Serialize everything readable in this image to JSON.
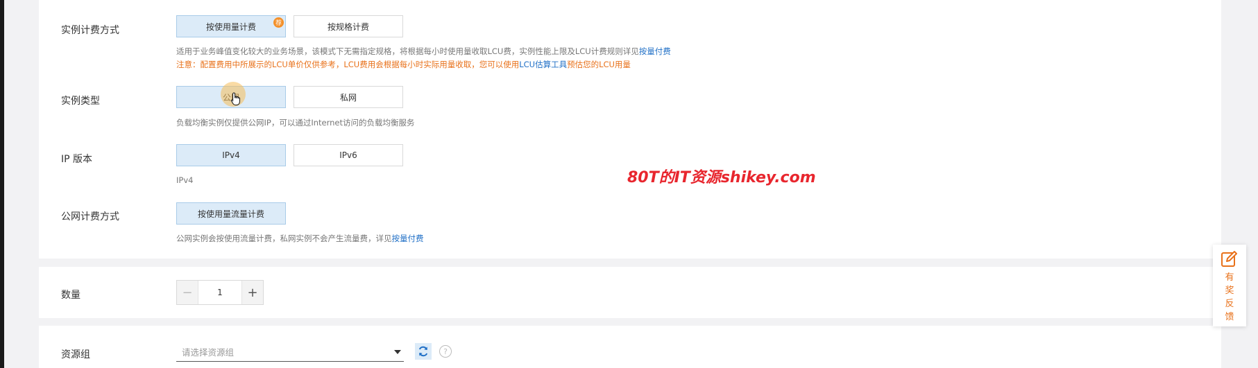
{
  "billing": {
    "label": "实例计费方式",
    "options": [
      "按使用量计费",
      "按规格计费"
    ],
    "badge": "荐",
    "hint_text": "适用于业务峰值变化较大的业务场景，该模式下无需指定规格，将根据每小时使用量收取LCU费，实例性能上限及LCU计费规则详见",
    "hint_link": "按量付费",
    "warn_text_1": "注意：配置费用中所展示的LCU单价仅供参考，LCU费用会根据每小时实际用量收取，您可以使用",
    "warn_link": "LCU估算工具",
    "warn_text_2": "预估您的LCU用量"
  },
  "instance_type": {
    "label": "实例类型",
    "options": [
      "公网",
      "私网"
    ],
    "hint": "负载均衡实例仅提供公网IP，可以通过Internet访问的负载均衡服务"
  },
  "ip_version": {
    "label": "IP 版本",
    "options": [
      "IPv4",
      "IPv6"
    ],
    "hint": "IPv4"
  },
  "public_billing": {
    "label": "公网计费方式",
    "option": "按使用量流量计费",
    "hint_text": "公网实例会按使用流量计费，私网实例不会产生流量费，详见",
    "hint_link": "按量付费"
  },
  "quantity": {
    "label": "数量",
    "value": "1",
    "minus": "−",
    "plus": "+"
  },
  "resource_group": {
    "label": "资源组",
    "placeholder": "请选择资源组",
    "help": "?"
  },
  "watermark": "80T的IT资源shikey.com",
  "feedback": {
    "label": "有奖反馈"
  },
  "colors": {
    "accent": "#1f6fc6",
    "selected_bg": "#dcebf8",
    "warning": "#e8711a",
    "watermark": "#e8262e"
  }
}
